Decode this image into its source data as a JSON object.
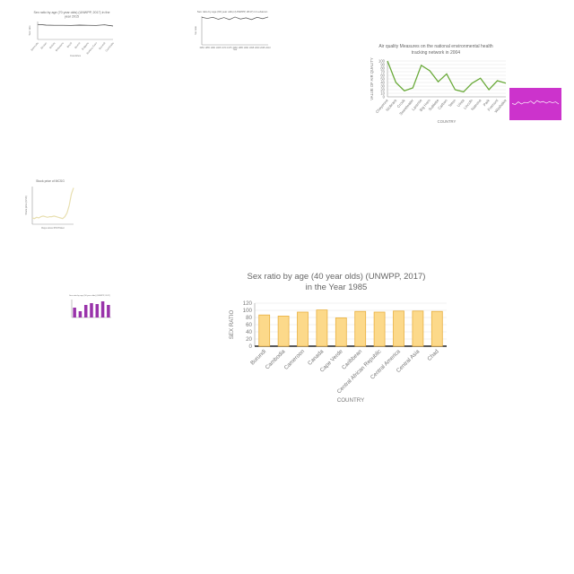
{
  "chart_data": [
    {
      "id": "c1",
      "type": "line",
      "title_lines": [
        "Sex ratio by age (70 year olds) (UNWPP, 2017) in the",
        "year 2015"
      ],
      "xlabel": "Countries",
      "ylabel": "Sex ratio",
      "categories": [
        "Bermuda",
        "Bhutan",
        "Bolivia",
        "Botswana",
        "Brazil",
        "Brunei",
        "Bulgaria",
        "Burkina Faso",
        "Burundi",
        "Cambodia"
      ],
      "values": [
        101,
        96,
        95,
        95,
        94,
        96,
        95,
        94,
        98,
        90
      ],
      "ylim": [
        0,
        120
      ],
      "color": "#333333"
    },
    {
      "id": "c2",
      "type": "line",
      "title_lines": [
        "Sex ratio by age (60 year olds) (UNWPP, 2017) in Lebanon"
      ],
      "xlabel": "Year",
      "ylabel": "Sex ratio",
      "categories": [
        "1950",
        "1955",
        "1960",
        "1965",
        "1970",
        "1975",
        "1980",
        "1985",
        "1990",
        "1995",
        "2000",
        "2005",
        "2010"
      ],
      "values": [
        96,
        92,
        96,
        89,
        95,
        88,
        97,
        90,
        94,
        88,
        96,
        91,
        97
      ],
      "ylim": [
        0,
        100
      ],
      "color": "#555555"
    },
    {
      "id": "c3",
      "type": "line",
      "title_lines": [
        "Air quality Measures on the national environmental health",
        "tracking network in 2004"
      ],
      "xlabel": "COUNTRY",
      "ylabel": "VALUE OF AIR QUALITY",
      "categories": [
        "Cheyenne",
        "Niobrara",
        "Crook",
        "Sweetwater",
        "Laramie",
        "Big Horn",
        "Sublette",
        "Carbon",
        "Teton",
        "Uinta",
        "Lincoln",
        "Natrona",
        "Park",
        "Fremont",
        "Washakie"
      ],
      "values": [
        100,
        40,
        17,
        25,
        88,
        73,
        42,
        64,
        20,
        14,
        38,
        52,
        20,
        45,
        38
      ],
      "yticks": [
        0,
        10,
        20,
        30,
        40,
        50,
        60,
        70,
        80,
        90,
        100
      ],
      "ylim": [
        0,
        100
      ],
      "color": "#6aaa3a"
    },
    {
      "id": "c4",
      "type": "line",
      "title_lines": [
        ""
      ],
      "xlabel": "",
      "ylabel": "",
      "values": [
        52,
        48,
        60,
        50,
        58,
        55,
        64,
        52,
        66,
        58,
        62,
        54,
        61,
        56,
        60,
        50
      ],
      "ylim": [
        0,
        100
      ],
      "color": "#ffffff",
      "background": "#cc33cc"
    },
    {
      "id": "c5",
      "type": "line",
      "title_lines": [
        "Stock price of MCSG"
      ],
      "xlabel": "Days since IPO/Ticker",
      "ylabel": "Share price (USD)",
      "values": [
        10,
        9,
        11,
        10,
        12,
        13,
        12,
        11,
        12,
        12,
        13,
        12,
        11,
        10,
        9,
        12,
        18,
        30,
        48,
        58
      ],
      "ylim": [
        0,
        60
      ],
      "color": "#e8dfb0"
    },
    {
      "id": "c6",
      "type": "bar",
      "title_lines": [
        "Sex ratio by age (50 year olds) (UNWPP, 2017)"
      ],
      "xlabel": "",
      "ylabel": "",
      "values": [
        55,
        35,
        70,
        80,
        75,
        90,
        70
      ],
      "ylim": [
        0,
        100
      ],
      "color": "#9933aa"
    },
    {
      "id": "c7",
      "type": "bar",
      "title_lines": [
        "Sex ratio by age (40 year olds) (UNWPP, 2017)",
        "in the Year 1985"
      ],
      "xlabel": "COUNTRY",
      "ylabel": "SEX RATIO",
      "categories": [
        "Burundi",
        "Cambodia",
        "Cameroon",
        "Canada",
        "Cape Verde",
        "Caribbean",
        "Central African Republic",
        "Central America",
        "Central Asia",
        "Chad"
      ],
      "values": [
        87,
        84,
        95,
        101,
        79,
        97,
        95,
        98,
        98,
        97
      ],
      "yticks": [
        0,
        20,
        40,
        60,
        80,
        100,
        120
      ],
      "ylim": [
        0,
        120
      ],
      "color": "#fcd98a",
      "stroke": "#e8b040"
    }
  ]
}
